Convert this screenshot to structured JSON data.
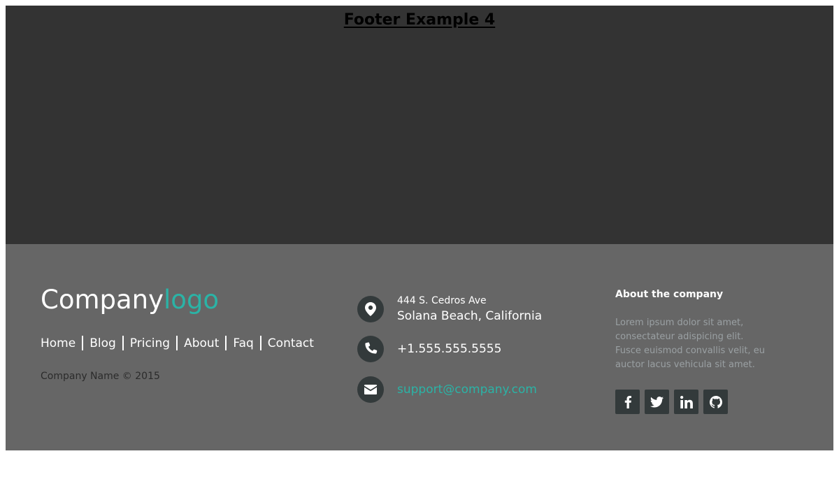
{
  "page": {
    "title": "Footer Example 4"
  },
  "footer": {
    "logo": {
      "text_main": "Company",
      "text_accent": "logo"
    },
    "links": [
      {
        "label": "Home"
      },
      {
        "label": "Blog"
      },
      {
        "label": "Pricing"
      },
      {
        "label": "About"
      },
      {
        "label": "Faq"
      },
      {
        "label": "Contact"
      }
    ],
    "copyright": "Company Name © 2015",
    "contact": {
      "address_line1": "444 S. Cedros Ave",
      "address_line2": "Solana Beach, California",
      "phone": "+1.555.555.5555",
      "email": "support@company.com"
    },
    "about": {
      "title": "About the company",
      "text": "Lorem ipsum dolor sit amet, consectateur adispicing elit. Fusce euismod convallis velit, eu auctor lacus vehicula sit amet."
    },
    "social": [
      {
        "icon": "facebook-icon"
      },
      {
        "icon": "twitter-icon"
      },
      {
        "icon": "linkedin-icon"
      },
      {
        "icon": "github-icon"
      }
    ]
  },
  "colors": {
    "page_background": "#333333",
    "footer_background": "#666666",
    "accent": "#2bb3a6",
    "icon_background": "#333a3b",
    "about_text": "#9aa0a3"
  }
}
